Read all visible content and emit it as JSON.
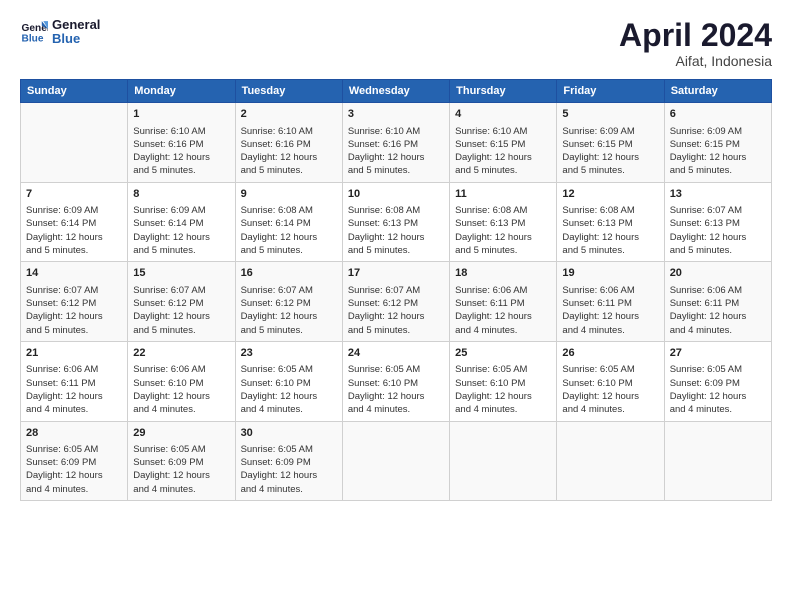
{
  "header": {
    "logo_general": "General",
    "logo_blue": "Blue",
    "title": "April 2024",
    "subtitle": "Aifat, Indonesia"
  },
  "columns": [
    "Sunday",
    "Monday",
    "Tuesday",
    "Wednesday",
    "Thursday",
    "Friday",
    "Saturday"
  ],
  "weeks": [
    [
      {
        "day": "",
        "info": ""
      },
      {
        "day": "1",
        "info": "Sunrise: 6:10 AM\nSunset: 6:16 PM\nDaylight: 12 hours\nand 5 minutes."
      },
      {
        "day": "2",
        "info": "Sunrise: 6:10 AM\nSunset: 6:16 PM\nDaylight: 12 hours\nand 5 minutes."
      },
      {
        "day": "3",
        "info": "Sunrise: 6:10 AM\nSunset: 6:16 PM\nDaylight: 12 hours\nand 5 minutes."
      },
      {
        "day": "4",
        "info": "Sunrise: 6:10 AM\nSunset: 6:15 PM\nDaylight: 12 hours\nand 5 minutes."
      },
      {
        "day": "5",
        "info": "Sunrise: 6:09 AM\nSunset: 6:15 PM\nDaylight: 12 hours\nand 5 minutes."
      },
      {
        "day": "6",
        "info": "Sunrise: 6:09 AM\nSunset: 6:15 PM\nDaylight: 12 hours\nand 5 minutes."
      }
    ],
    [
      {
        "day": "7",
        "info": "Sunrise: 6:09 AM\nSunset: 6:14 PM\nDaylight: 12 hours\nand 5 minutes."
      },
      {
        "day": "8",
        "info": "Sunrise: 6:09 AM\nSunset: 6:14 PM\nDaylight: 12 hours\nand 5 minutes."
      },
      {
        "day": "9",
        "info": "Sunrise: 6:08 AM\nSunset: 6:14 PM\nDaylight: 12 hours\nand 5 minutes."
      },
      {
        "day": "10",
        "info": "Sunrise: 6:08 AM\nSunset: 6:13 PM\nDaylight: 12 hours\nand 5 minutes."
      },
      {
        "day": "11",
        "info": "Sunrise: 6:08 AM\nSunset: 6:13 PM\nDaylight: 12 hours\nand 5 minutes."
      },
      {
        "day": "12",
        "info": "Sunrise: 6:08 AM\nSunset: 6:13 PM\nDaylight: 12 hours\nand 5 minutes."
      },
      {
        "day": "13",
        "info": "Sunrise: 6:07 AM\nSunset: 6:13 PM\nDaylight: 12 hours\nand 5 minutes."
      }
    ],
    [
      {
        "day": "14",
        "info": "Sunrise: 6:07 AM\nSunset: 6:12 PM\nDaylight: 12 hours\nand 5 minutes."
      },
      {
        "day": "15",
        "info": "Sunrise: 6:07 AM\nSunset: 6:12 PM\nDaylight: 12 hours\nand 5 minutes."
      },
      {
        "day": "16",
        "info": "Sunrise: 6:07 AM\nSunset: 6:12 PM\nDaylight: 12 hours\nand 5 minutes."
      },
      {
        "day": "17",
        "info": "Sunrise: 6:07 AM\nSunset: 6:12 PM\nDaylight: 12 hours\nand 5 minutes."
      },
      {
        "day": "18",
        "info": "Sunrise: 6:06 AM\nSunset: 6:11 PM\nDaylight: 12 hours\nand 4 minutes."
      },
      {
        "day": "19",
        "info": "Sunrise: 6:06 AM\nSunset: 6:11 PM\nDaylight: 12 hours\nand 4 minutes."
      },
      {
        "day": "20",
        "info": "Sunrise: 6:06 AM\nSunset: 6:11 PM\nDaylight: 12 hours\nand 4 minutes."
      }
    ],
    [
      {
        "day": "21",
        "info": "Sunrise: 6:06 AM\nSunset: 6:11 PM\nDaylight: 12 hours\nand 4 minutes."
      },
      {
        "day": "22",
        "info": "Sunrise: 6:06 AM\nSunset: 6:10 PM\nDaylight: 12 hours\nand 4 minutes."
      },
      {
        "day": "23",
        "info": "Sunrise: 6:05 AM\nSunset: 6:10 PM\nDaylight: 12 hours\nand 4 minutes."
      },
      {
        "day": "24",
        "info": "Sunrise: 6:05 AM\nSunset: 6:10 PM\nDaylight: 12 hours\nand 4 minutes."
      },
      {
        "day": "25",
        "info": "Sunrise: 6:05 AM\nSunset: 6:10 PM\nDaylight: 12 hours\nand 4 minutes."
      },
      {
        "day": "26",
        "info": "Sunrise: 6:05 AM\nSunset: 6:10 PM\nDaylight: 12 hours\nand 4 minutes."
      },
      {
        "day": "27",
        "info": "Sunrise: 6:05 AM\nSunset: 6:09 PM\nDaylight: 12 hours\nand 4 minutes."
      }
    ],
    [
      {
        "day": "28",
        "info": "Sunrise: 6:05 AM\nSunset: 6:09 PM\nDaylight: 12 hours\nand 4 minutes."
      },
      {
        "day": "29",
        "info": "Sunrise: 6:05 AM\nSunset: 6:09 PM\nDaylight: 12 hours\nand 4 minutes."
      },
      {
        "day": "30",
        "info": "Sunrise: 6:05 AM\nSunset: 6:09 PM\nDaylight: 12 hours\nand 4 minutes."
      },
      {
        "day": "",
        "info": ""
      },
      {
        "day": "",
        "info": ""
      },
      {
        "day": "",
        "info": ""
      },
      {
        "day": "",
        "info": ""
      }
    ]
  ]
}
